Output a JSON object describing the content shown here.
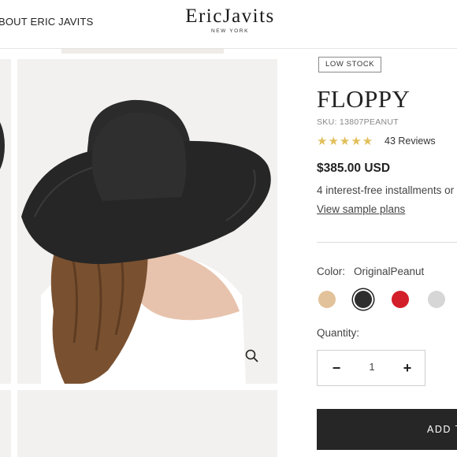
{
  "header": {
    "nav_link": "BOUT ERIC JAVITS",
    "logo_name": "EricJavits",
    "logo_sub": "NEW YORK"
  },
  "gallery": {
    "zoom_icon": "search-icon"
  },
  "product": {
    "badge": "LOW STOCK",
    "title": "FLOPPY",
    "sku": "SKU: 13807PEANUT",
    "rating_stars": "★★★★★",
    "rating_value": 5,
    "reviews": "43 Reviews",
    "price": "$385.00 USD",
    "installments": "4 interest-free installments or",
    "sample_plans": "View sample plans"
  },
  "color": {
    "label": "Color:",
    "value": "OriginalPeanut",
    "swatches": [
      {
        "name": "peanut",
        "hex": "#e2c29a",
        "selected": false
      },
      {
        "name": "black",
        "hex": "#2e2e2e",
        "selected": true
      },
      {
        "name": "red",
        "hex": "#d31f2a",
        "selected": false
      },
      {
        "name": "grey",
        "hex": "#d6d6d6",
        "selected": false
      }
    ]
  },
  "quantity": {
    "label": "Quantity:",
    "minus": "−",
    "value": "1",
    "plus": "+"
  },
  "add_button": {
    "label": "ADD T"
  },
  "colors": {
    "star": "#e2bf5a",
    "button_bg": "#262626",
    "image_bg": "#f3f1ef"
  }
}
